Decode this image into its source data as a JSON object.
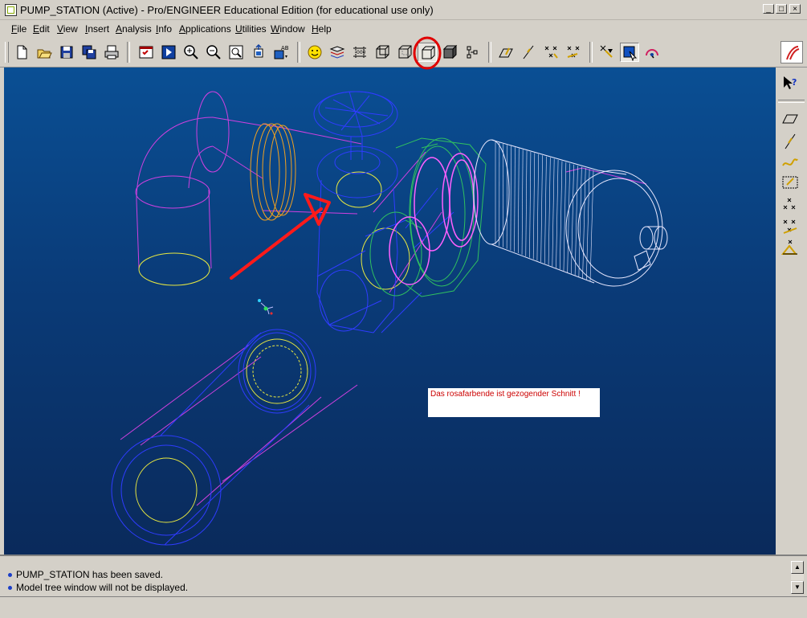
{
  "window": {
    "title": "PUMP_STATION (Active) - Pro/ENGINEER Educational Edition (for educational use only)",
    "minimize_glyph": "_",
    "maximize_glyph": "□",
    "close_glyph": "×"
  },
  "menu": {
    "items": [
      {
        "first": "F",
        "rest": "ile"
      },
      {
        "first": "E",
        "rest": "dit"
      },
      {
        "first": "V",
        "rest": "iew"
      },
      {
        "first": "I",
        "rest": "nsert"
      },
      {
        "first": "A",
        "rest": "nalysis"
      },
      {
        "first": "I",
        "rest": "nfo"
      },
      {
        "first": "A",
        "rest": "pplications"
      },
      {
        "first": "U",
        "rest": "tilities"
      },
      {
        "first": "W",
        "rest": "indow"
      },
      {
        "first": "H",
        "rest": "elp"
      }
    ]
  },
  "toolbar": {
    "icons": [
      "new-file-icon",
      "open-folder-icon",
      "save-icon",
      "save-copy-icon",
      "print-icon",
      "model-tree-icon",
      "play-icon",
      "zoom-in-icon",
      "zoom-out-icon",
      "refit-icon",
      "reorient-icon",
      "named-view-icon",
      "smiley-icon",
      "layers-icon",
      "datum-display-icon",
      "wireframe-icon",
      "hidden-line-icon",
      "no-hidden-icon",
      "shading-icon",
      "datum-points-icon",
      "datum-plane-icon",
      "datum-axis-icon",
      "datum-point-sketch-icon",
      "coordinate-system-icon",
      "select-icon",
      "filter-icon",
      "spin-center-icon"
    ],
    "highlight_color": "#e00000"
  },
  "viewport": {
    "annotation_text": "Das rosafarbende ist gezogender Schnitt !",
    "annotation_color": "#cc0000",
    "arrow_color": "#ff1a1a",
    "bg_top": "#0a4f94",
    "bg_bottom": "#0a2a5b",
    "line_colors": {
      "magenta": "#d040e0",
      "blue": "#2f3cff",
      "yellow": "#e8e840",
      "orange": "#f0a020",
      "green": "#30c060",
      "white": "#e8e8ff"
    }
  },
  "right_tools": [
    "help-pointer-icon",
    "datum-plane-icon",
    "datum-axis-icon",
    "datum-curve-icon",
    "datum-point-offset-icon",
    "datum-point-icon",
    "coord-sys-icon",
    "analysis-icon"
  ],
  "messages": [
    "PUMP_STATION has been saved.",
    "Model tree window will not be displayed."
  ]
}
